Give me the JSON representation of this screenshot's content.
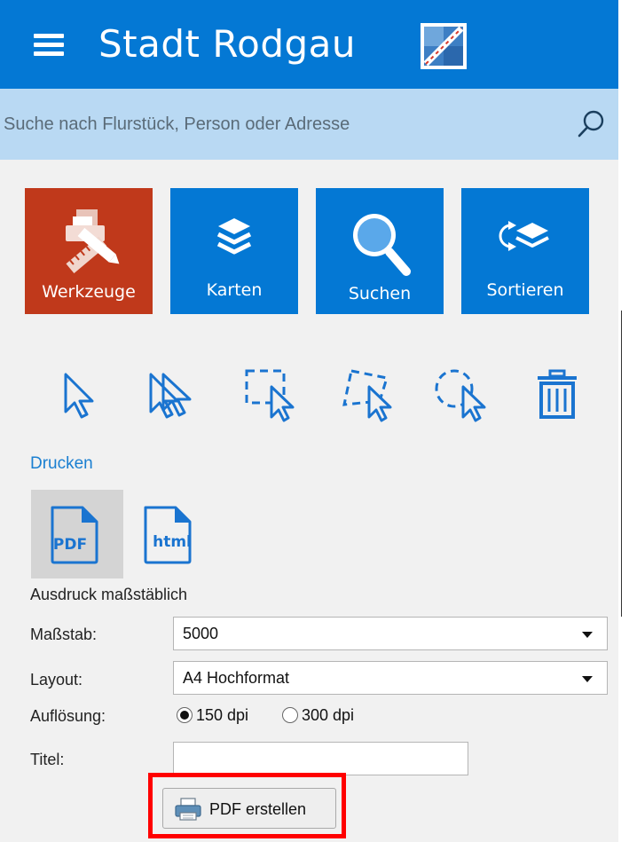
{
  "header": {
    "title": "Stadt Rodgau"
  },
  "search": {
    "placeholder": "Suche nach Flurstück, Person oder Adresse"
  },
  "tiles": [
    {
      "label": "Werkzeuge",
      "active": true
    },
    {
      "label": "Karten"
    },
    {
      "label": "Suchen"
    },
    {
      "label": "Sortieren"
    }
  ],
  "print": {
    "section_label": "Drucken",
    "pdf_icon_text": "PDF",
    "html_icon_text": "html",
    "scale_heading": "Ausdruck maßstäblich",
    "scale_label": "Maßstab:",
    "scale_value": "5000",
    "layout_label": "Layout:",
    "layout_value": "A4 Hochformat",
    "resolution_label": "Auflösung:",
    "resolution_options": [
      "150 dpi",
      "300 dpi"
    ],
    "title_label": "Titel:",
    "title_value": "",
    "create_button": "PDF erstellen"
  },
  "colors": {
    "header": "#0478d4",
    "search_bar": "#b9d9f3",
    "active_tile": "#c0391b",
    "link": "#1a7fd1",
    "highlight": "#ff0000"
  }
}
